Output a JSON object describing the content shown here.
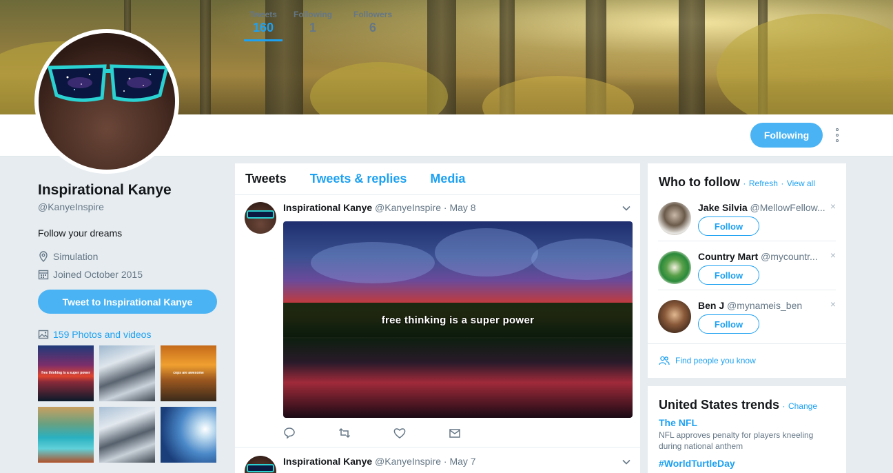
{
  "profile": {
    "name": "Inspirational Kanye",
    "handle": "@KanyeInspire",
    "bio": "Follow your dreams",
    "location": "Simulation",
    "joined": "Joined October 2015",
    "tweet_to_label": "Tweet to Inspirational Kanye",
    "photos_label": "159 Photos and videos",
    "thumb_caption_1": "free thinking is a super power",
    "thumb_caption_3": "cops are awesome"
  },
  "stats": [
    {
      "label": "Tweets",
      "value": "160"
    },
    {
      "label": "Following",
      "value": "1"
    },
    {
      "label": "Followers",
      "value": "6"
    }
  ],
  "header": {
    "following_label": "Following"
  },
  "tabs": [
    "Tweets",
    "Tweets & replies",
    "Media"
  ],
  "tweets": [
    {
      "name": "Inspirational Kanye",
      "handle": "@KanyeInspire",
      "date": "May 8",
      "image_caption": "free thinking is a super power"
    },
    {
      "name": "Inspirational Kanye",
      "handle": "@KanyeInspire",
      "date": "May 7"
    }
  ],
  "who_to_follow": {
    "title": "Who to follow",
    "refresh": "Refresh",
    "view_all": "View all",
    "sep": "·",
    "users": [
      {
        "name": "Jake Silvia",
        "handle": "@MellowFellow...",
        "button": "Follow"
      },
      {
        "name": "Country Mart",
        "handle": "@mycountr...",
        "button": "Follow"
      },
      {
        "name": "Ben J",
        "handle": "@mynameis_ben",
        "button": "Follow"
      }
    ],
    "close_glyph": "×",
    "find_people": "Find people you know"
  },
  "trends": {
    "title": "United States trends",
    "change": "Change",
    "items": [
      {
        "name": "The NFL",
        "desc": "NFL approves penalty for players kneeling during national anthem"
      },
      {
        "name": "#WorldTurtleDay",
        "desc": ""
      }
    ]
  },
  "colors": {
    "accent": "#1da1f2",
    "button_bg": "#4ab3f4",
    "page_bg": "#e6ecf0",
    "muted": "#657786"
  },
  "icons": [
    "location-icon",
    "calendar-icon",
    "photo-icon",
    "chevron-down-icon",
    "reply-icon",
    "retweet-icon",
    "like-icon",
    "message-icon",
    "people-icon",
    "more-icon",
    "close-icon"
  ]
}
